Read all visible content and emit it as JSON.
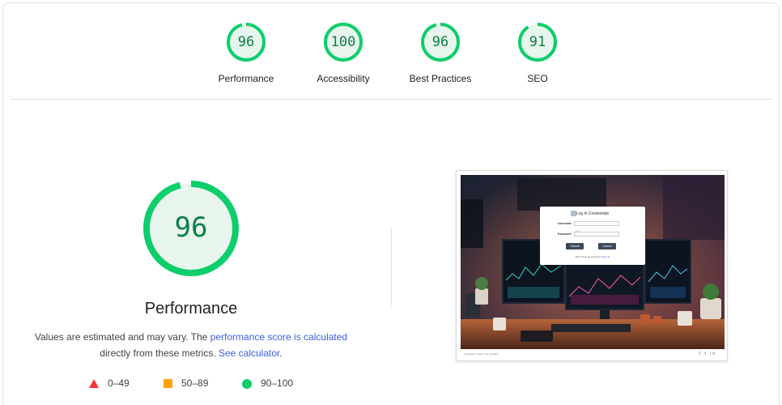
{
  "categories": [
    {
      "key": "performance",
      "score": "96",
      "label": "Performance",
      "value": 96
    },
    {
      "key": "accessibility",
      "score": "100",
      "label": "Accessibility",
      "value": 100
    },
    {
      "key": "best-practices",
      "score": "96",
      "label": "Best Practices",
      "value": 96
    },
    {
      "key": "seo",
      "score": "91",
      "label": "SEO",
      "value": 91
    }
  ],
  "main": {
    "score": "96",
    "value": 96,
    "title": "Performance",
    "desc_prefix": "Values are estimated and may vary. The ",
    "desc_link1": "performance score is calculated",
    "desc_middle": "directly from these metrics. ",
    "desc_link2": "See calculator",
    "desc_suffix": "."
  },
  "legend": {
    "fail": "0–49",
    "average": "50–89",
    "pass": "90–100"
  },
  "thumbnail": {
    "login_title": "Log in Credentials",
    "username_label": "Username",
    "username_value": "test",
    "password_label": "Password",
    "submit_label": "Submit",
    "cancel_label": "Cancel",
    "signup_prefix": "Don't have an account? ",
    "signup_link": "Sign up",
    "footer_copyright": "Copyright © 2024 Your company",
    "footer_icons": "f t in"
  },
  "colors": {
    "pass": "#0cce6b",
    "pass_text": "#0b8043",
    "pass_fill": "#e8f5ec",
    "average": "#ffa400",
    "fail": "#ff3333",
    "link": "#3c5ee6"
  }
}
